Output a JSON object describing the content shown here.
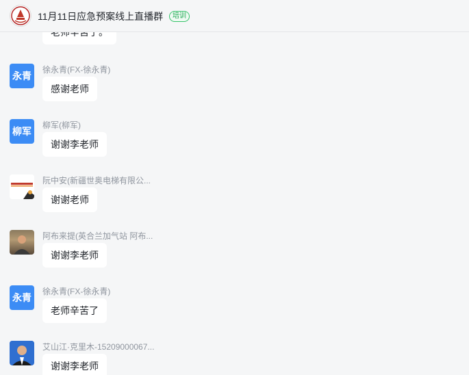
{
  "header": {
    "title": "11月11日应急预案线上直播群",
    "tag": "培训"
  },
  "messages": [
    {
      "sender": "",
      "text": "老师辛苦了。",
      "avatar_type": "none"
    },
    {
      "sender": "徐永青(FX-徐永青)",
      "text": "感谢老师",
      "avatar_type": "text",
      "avatar_text": "永青"
    },
    {
      "sender": "柳军(柳军)",
      "text": "谢谢李老师",
      "avatar_type": "text",
      "avatar_text": "柳军"
    },
    {
      "sender": "阮中安(新疆世奥电梯有限公...",
      "text": "谢谢老师",
      "avatar_type": "image"
    },
    {
      "sender": "阿布来提(英合兰加气站 阿布...",
      "text": "谢谢李老师",
      "avatar_type": "image"
    },
    {
      "sender": "徐永青(FX-徐永青)",
      "text": "老师辛苦了",
      "avatar_type": "text",
      "avatar_text": "永青"
    },
    {
      "sender": "艾山江·克里木-15209000067...",
      "text": "谢谢李老师",
      "avatar_type": "image"
    }
  ]
}
